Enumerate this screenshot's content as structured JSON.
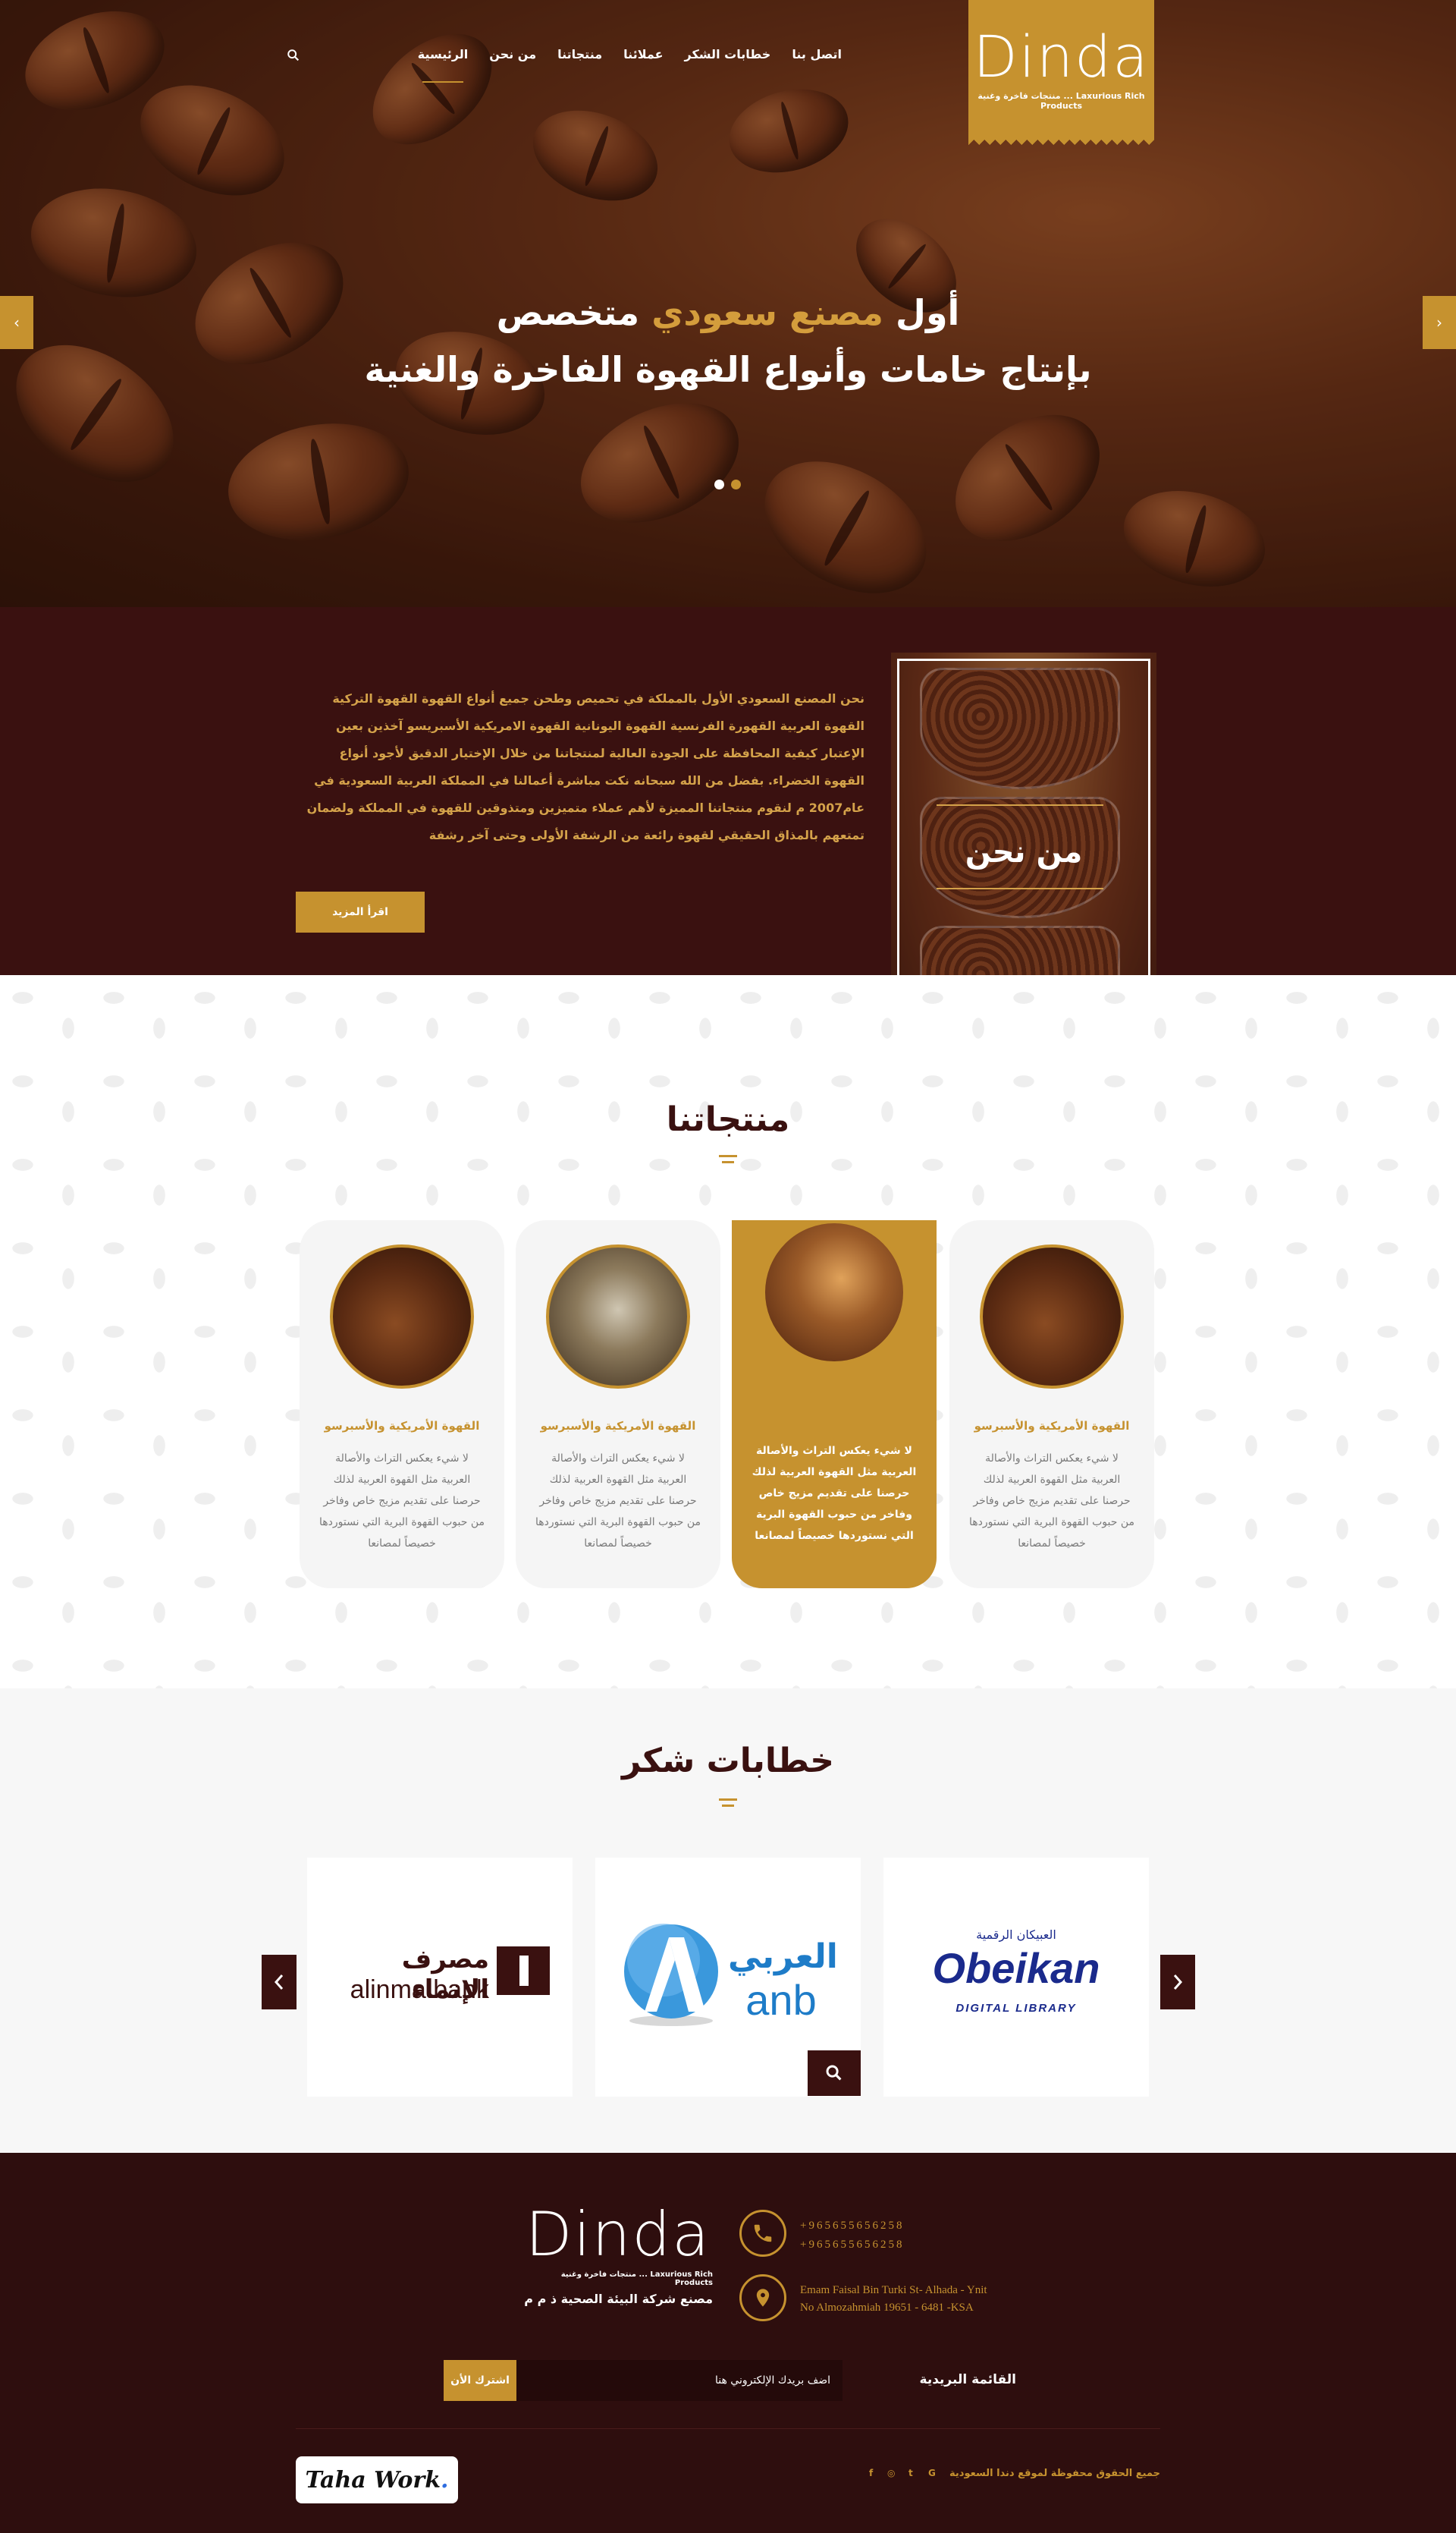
{
  "brand": {
    "logo_text": "Dinda",
    "tagline": "منتجات فاخرة وغنية ... Laxurious Rich Products",
    "accent": "#c6922f",
    "dark": "#3a1110"
  },
  "nav": {
    "items": [
      "الرئيسية",
      "من نحن",
      "منتجاتنا",
      "عملائنا",
      "خطابات الشكر",
      "اتصل بنا"
    ],
    "active_index": 0
  },
  "hero": {
    "line1_prefix": "أول",
    "line1_gold": "مصنع سعودي",
    "line1_suffix": "متخصص",
    "line2": "بإنتاج خامات وأنواع القهوة الفاخرة والغنية",
    "prev": "‹",
    "next": "›"
  },
  "about": {
    "title": "من نحن",
    "text": "نحن المصنع السعودي الأول بالمملكة في تحميص وطحن جميع أنواع القهوة القهوة التركية القهوة العربية القهورة الفرنسية القهوة اليونانية القهوة الامريكية الأسبريسو آخذين بعين الإعتبار كيفية المحافظة على الجودة العالية لمنتجاتنا من خلال الإختيار الدقيق لأجود أنواع القهوة الخضراء. بفضل من الله سبحانه نكت مباشرة أعمالنا في المملكة العربية السعودية في عام2007 م لنقوم منتجاتنا المميزة لأهم عملاء متميزين ومتذوقين للقهوة في المملكة ولضمان تمتعهم بالمذاق الحقيقي لقهوة رائعة من الرشفة الأولى وحتى آخر رشفة",
    "button": "اقرأ المزيد"
  },
  "products": {
    "title": "منتجاتنا",
    "cards": [
      {
        "name": "القهوة الأمريكية والأسبرسو",
        "desc": "لا شيء يعكس التراث والأصالة العربية مثل القهوة العربية لذلك حرصنا على تقديم مزيج خاص وفاخر من حبوب القهوة البرية التي نستوردها خصيصاً لمصانعا",
        "featured": false
      },
      {
        "name": "القهوة الأمريكية والأسبرسو",
        "desc": "لا شيء يعكس التراث والأصالة العربية مثل القهوة العربية لذلك حرصنا على تقديم مزيج خاص وفاخر من حبوب القهوة البرية التي نستوردها خصيصاً لمصانعا",
        "featured": false
      },
      {
        "name": "",
        "desc": "لا شيء يعكس التراث والأصالة العربية مثل القهوة العربية لذلك حرصنا على تقديم مزيج خاص وفاخر من حبوب القهوة البرية التي نستوردها خصيصاً لمصانعا",
        "featured": true
      },
      {
        "name": "القهوة الأمريكية والأسبرسو",
        "desc": "لا شيء يعكس التراث والأصالة العربية مثل القهوة العربية لذلك حرصنا على تقديم مزيج خاص وفاخر من حبوب القهوة البرية التي نستوردها خصيصاً لمصانعا",
        "featured": false
      }
    ]
  },
  "thanks": {
    "title": "خطابات شكر",
    "logos": [
      {
        "ar": "مصرف الإنماء",
        "en": "alinma bank"
      },
      {
        "ar": "العربي",
        "en": "anb"
      },
      {
        "ar": "العبيكان الرقمية",
        "en": "Obeikan",
        "sub": "DIGITAL LIBRARY"
      }
    ]
  },
  "footer": {
    "logo_text": "Dinda",
    "tagline": "منتجات فاخرة وغنية ... Laxurious Rich Products",
    "company": "مصنع شركة البيئة الصحية ذ م م",
    "phone1": "+965655656258",
    "phone2": "+965655656258",
    "address1": "Emam Faisal Bin Turki St- Alhada - Ynit",
    "address2": "No Almozahmiah 19651 - 6481 -KSA",
    "newsletter_label": "القائمة البريدية",
    "newsletter_placeholder": "اضف بريدك الإلكتروني هنا",
    "newsletter_button": "اشترك الأن",
    "copyright": "جميع الحقوق محفوظة لموقع دندا السعودية",
    "social": [
      "G",
      "t",
      "◎",
      "f"
    ],
    "badge": "Taha Work"
  }
}
